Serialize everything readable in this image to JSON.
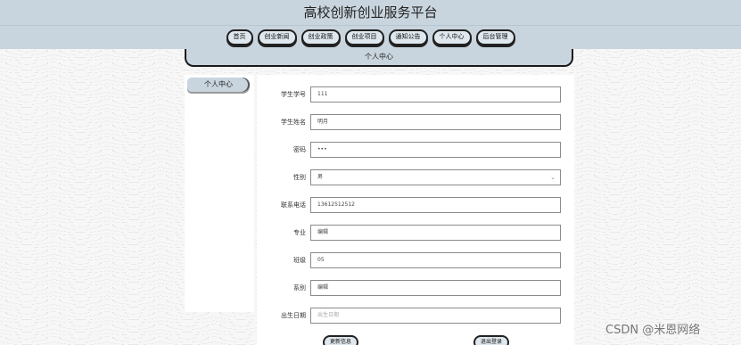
{
  "header": {
    "title": "高校创新创业服务平台"
  },
  "nav": [
    {
      "label": "首页"
    },
    {
      "label": "创业新闻"
    },
    {
      "label": "创业政策"
    },
    {
      "label": "创业项目"
    },
    {
      "label": "通知公告"
    },
    {
      "label": "个人中心"
    },
    {
      "label": "后台管理"
    }
  ],
  "section": {
    "title": "个人中心"
  },
  "sidebar": {
    "items": [
      {
        "label": "个人中心"
      }
    ]
  },
  "form": {
    "fields": [
      {
        "label": "学生学号",
        "value": "111"
      },
      {
        "label": "学生姓名",
        "value": "明月"
      },
      {
        "label": "密码",
        "value": "•••"
      },
      {
        "label": "性别",
        "value": "男"
      },
      {
        "label": "联系电话",
        "value": "13612512512"
      },
      {
        "label": "专业",
        "value": "编辑"
      },
      {
        "label": "班级",
        "value": "05"
      },
      {
        "label": "系别",
        "value": "编辑"
      },
      {
        "label": "出生日期",
        "value": "",
        "placeholder": "出生日期"
      }
    ],
    "update_button": "更新信息",
    "logout_button": "退出登录"
  },
  "watermark": "CSDN @米恩网络"
}
